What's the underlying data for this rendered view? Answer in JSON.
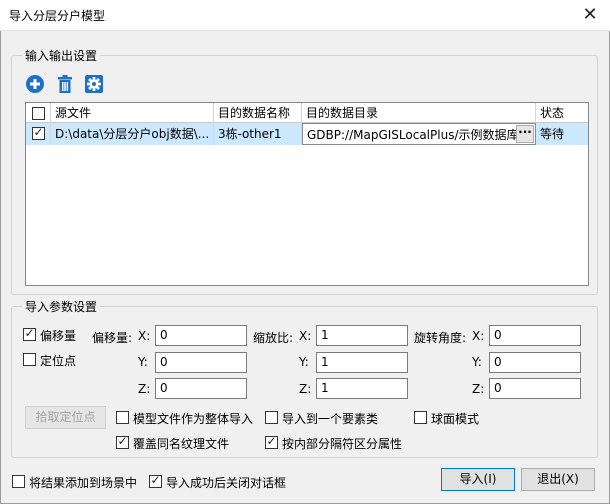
{
  "window": {
    "title": "导入分层分户模型",
    "close_glyph": "✕"
  },
  "io_group": {
    "title": "输入输出设置",
    "toolbar": [
      {
        "name": "add-icon",
        "color": "#1e6fc7"
      },
      {
        "name": "delete-icon",
        "color": "#1e6fc7"
      },
      {
        "name": "settings-icon",
        "color": "#1e6fc7"
      }
    ],
    "columns": [
      "源文件",
      "目的数据名称",
      "目的数据目录",
      "状态"
    ],
    "rows": [
      {
        "checked": true,
        "source": "D:\\data\\分层分户obj数据\\...",
        "dest_name": "3栋-other1",
        "dest_dir": "GDBP://MapGISLocalPlus/示例数据库",
        "status": "等待",
        "dir_button": "···"
      }
    ]
  },
  "params_group": {
    "title": "导入参数设置",
    "offset_check": {
      "label": "偏移量",
      "checked": true
    },
    "anchor_check": {
      "label": "定位点",
      "checked": false
    },
    "offset": {
      "label": "偏移量:",
      "x": "0",
      "y": "0",
      "z": "0"
    },
    "scale": {
      "label": "缩放比:",
      "x": "1",
      "y": "1",
      "z": "1"
    },
    "rotate": {
      "label": "旋转角度:",
      "x": "0",
      "y": "0",
      "z": "0"
    },
    "axis_labels": {
      "x": "X:",
      "y": "Y:",
      "z": "Z:"
    },
    "pick_button": "拾取定位点",
    "options": [
      {
        "label": "模型文件作为整体导入",
        "checked": false
      },
      {
        "label": "导入到一个要素类",
        "checked": false
      },
      {
        "label": "球面模式",
        "checked": false
      },
      {
        "label": "覆盖同名纹理文件",
        "checked": true
      },
      {
        "label": "按内部分隔符区分属性",
        "checked": true
      }
    ]
  },
  "footer": {
    "add_to_scene": {
      "label": "将结果添加到场景中",
      "checked": false
    },
    "close_after": {
      "label": "导入成功后关闭对话框",
      "checked": true
    },
    "import_button": "导入(I)",
    "exit_button": "退出(X)"
  }
}
